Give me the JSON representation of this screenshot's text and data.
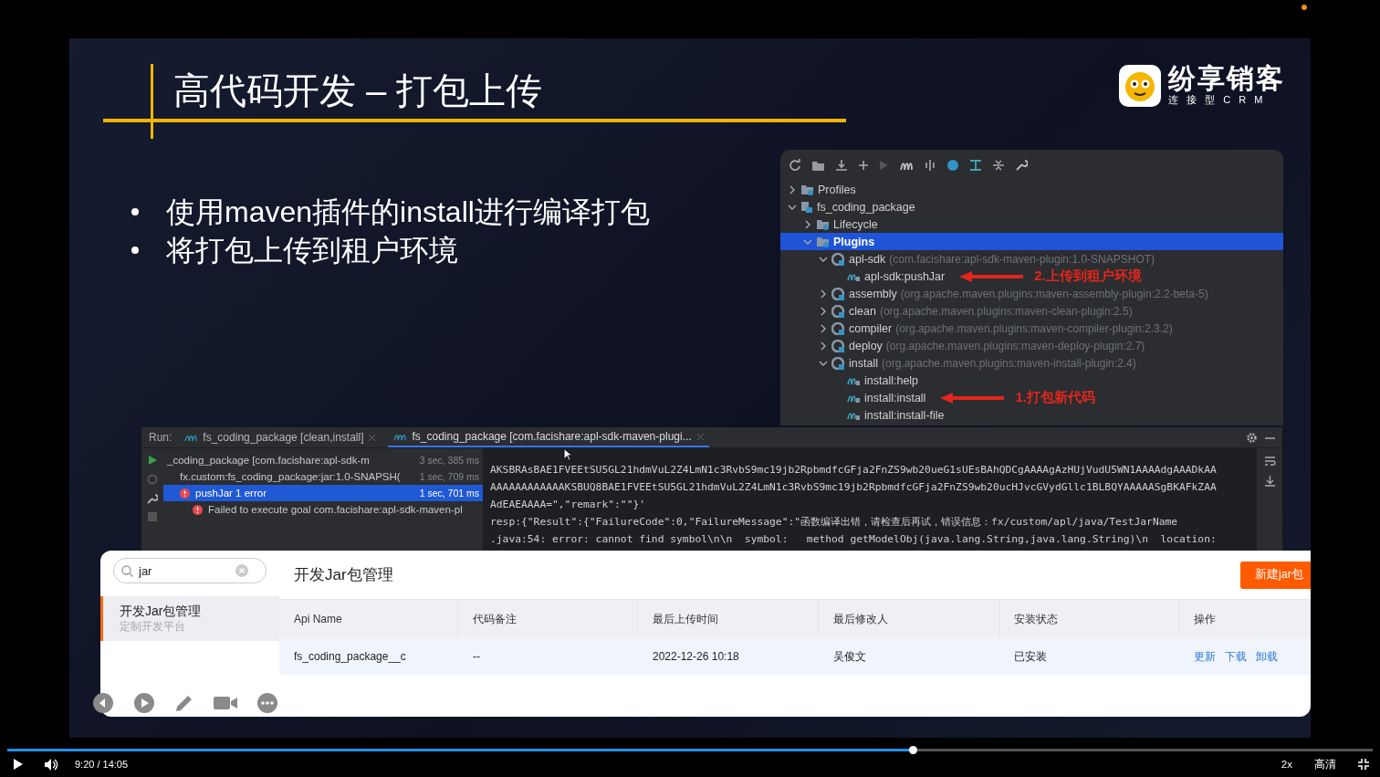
{
  "slide": {
    "title": "高代码开发 – 打包上传",
    "logo": {
      "name": "纷享销客",
      "tagline": "连 接 型 C R M"
    },
    "bullets": [
      "使用maven插件的install进行编译打包",
      "将打包上传到租户环境"
    ],
    "maven_panel": {
      "tree": [
        {
          "name": "Profiles",
          "kind": "folder",
          "expanded": false,
          "selected": false
        },
        {
          "name": "fs_coding_package",
          "kind": "project",
          "expanded": true,
          "selected": false,
          "children": [
            {
              "name": "Lifecycle",
              "kind": "folder",
              "expanded": false,
              "selected": false
            },
            {
              "name": "Plugins",
              "kind": "folder",
              "expanded": true,
              "selected": true,
              "children": [
                {
                  "name": "apl-sdk",
                  "detail": "(com.facishare:apl-sdk-maven-plugin:1.0-SNAPSHOT)",
                  "kind": "plugin",
                  "expanded": true,
                  "selected": false,
                  "children": [
                    {
                      "name": "apl-sdk:pushJar",
                      "kind": "goal",
                      "selected": false,
                      "annotation": "2.上传到租户环境"
                    }
                  ]
                },
                {
                  "name": "assembly",
                  "detail": "(org.apache.maven.plugins:maven-assembly-plugin:2.2-beta-5)",
                  "kind": "plugin",
                  "expanded": false,
                  "selected": false
                },
                {
                  "name": "clean",
                  "detail": "(org.apache.maven.plugins:maven-clean-plugin:2.5)",
                  "kind": "plugin",
                  "expanded": false,
                  "selected": false
                },
                {
                  "name": "compiler",
                  "detail": "(org.apache.maven.plugins:maven-compiler-plugin:2.3.2)",
                  "kind": "plugin",
                  "expanded": false,
                  "selected": false
                },
                {
                  "name": "deploy",
                  "detail": "(org.apache.maven.plugins:maven-deploy-plugin:2.7)",
                  "kind": "plugin",
                  "expanded": false,
                  "selected": false
                },
                {
                  "name": "install",
                  "detail": "(org.apache.maven.plugins:maven-install-plugin:2.4)",
                  "kind": "plugin",
                  "expanded": true,
                  "selected": false,
                  "children": [
                    {
                      "name": "install:help",
                      "kind": "goal",
                      "selected": false
                    },
                    {
                      "name": "install:install",
                      "kind": "goal",
                      "selected": false,
                      "annotation": "1.打包新代码"
                    },
                    {
                      "name": "install:install-file",
                      "kind": "goal",
                      "selected": false
                    }
                  ]
                }
              ]
            }
          ]
        }
      ]
    },
    "run_panel": {
      "label": "Run:",
      "tabs": [
        {
          "label": "fs_coding_package [clean,install]",
          "selected": false
        },
        {
          "label": "fs_coding_package [com.facishare:apl-sdk-maven-plugi...",
          "selected": true
        }
      ],
      "tree": [
        {
          "label": "_coding_package [com.facishare:apl-sdk-m",
          "time": "3 sec, 385 ms",
          "error": false,
          "selected": false,
          "children": [
            {
              "label": "fx.custom:fs_coding_package:jar:1.0-SNAPSH(",
              "time": "1 sec, 709 ms",
              "error": false,
              "selected": false
            },
            {
              "label": "pushJar  1 error",
              "time": "1 sec, 701 ms",
              "error": true,
              "selected": true,
              "children": [
                {
                  "label": "Failed to execute goal com.facishare:apl-sdk-maven-pl",
                  "error": true,
                  "selected": false
                }
              ]
            }
          ]
        }
      ],
      "console": [
        "AKSBRAsBAE1FVEEtSU5GL21hdmVuL2Z4LmN1c3RvbS9mc19jb2RpbmdfcGFja2FnZS9wb20ueG1sUEsBAhQDCgAAAAgAzHUjVudU5WN1AAAAdgAAADkAA",
        "AAAAAAAAAAAAKSBUQ8BAE1FVEEtSU5GL21hdmVuL2Z4LmN1c3RvbS9mc19jb2RpbmdfcGFja2FnZS9wb20ucHJvcGVydGllc1BLBQYAAAAASgBKAFkZAA",
        "AdEAEAAAA=\",\"remark\":\"\"}'",
        "resp:{\"Result\":{\"FailureCode\":0,\"FailureMessage\":\"函数编译出错，请检查后再试，错误信息：fx/custom/apl/java/TestJarName",
        ".java:54: error: cannot find symbol\\n\\n  symbol:   method getModelObj(java.lang.String,java.lang.String)\\n  location:"
      ]
    },
    "jar_manager": {
      "search": {
        "value": "jar"
      },
      "menu": [
        {
          "title": "开发Jar包管理",
          "subtitle": "定制开发平台",
          "selected": true
        }
      ],
      "heading": "开发Jar包管理",
      "new_button": "新建jar包",
      "table": {
        "columns": [
          "Api Name",
          "代码备注",
          "最后上传时间",
          "最后修改人",
          "安装状态",
          "操作"
        ],
        "rows": [
          {
            "cells": [
              "fs_coding_package__c",
              "--",
              "2022-12-26 10:18",
              "吴俊文",
              "已安装"
            ],
            "actions": [
              "更新",
              "下载",
              "卸载"
            ]
          }
        ]
      }
    }
  },
  "player": {
    "level": 0.663,
    "time": "9:20 / 14:05",
    "speed": "2x",
    "quality": "高清"
  }
}
